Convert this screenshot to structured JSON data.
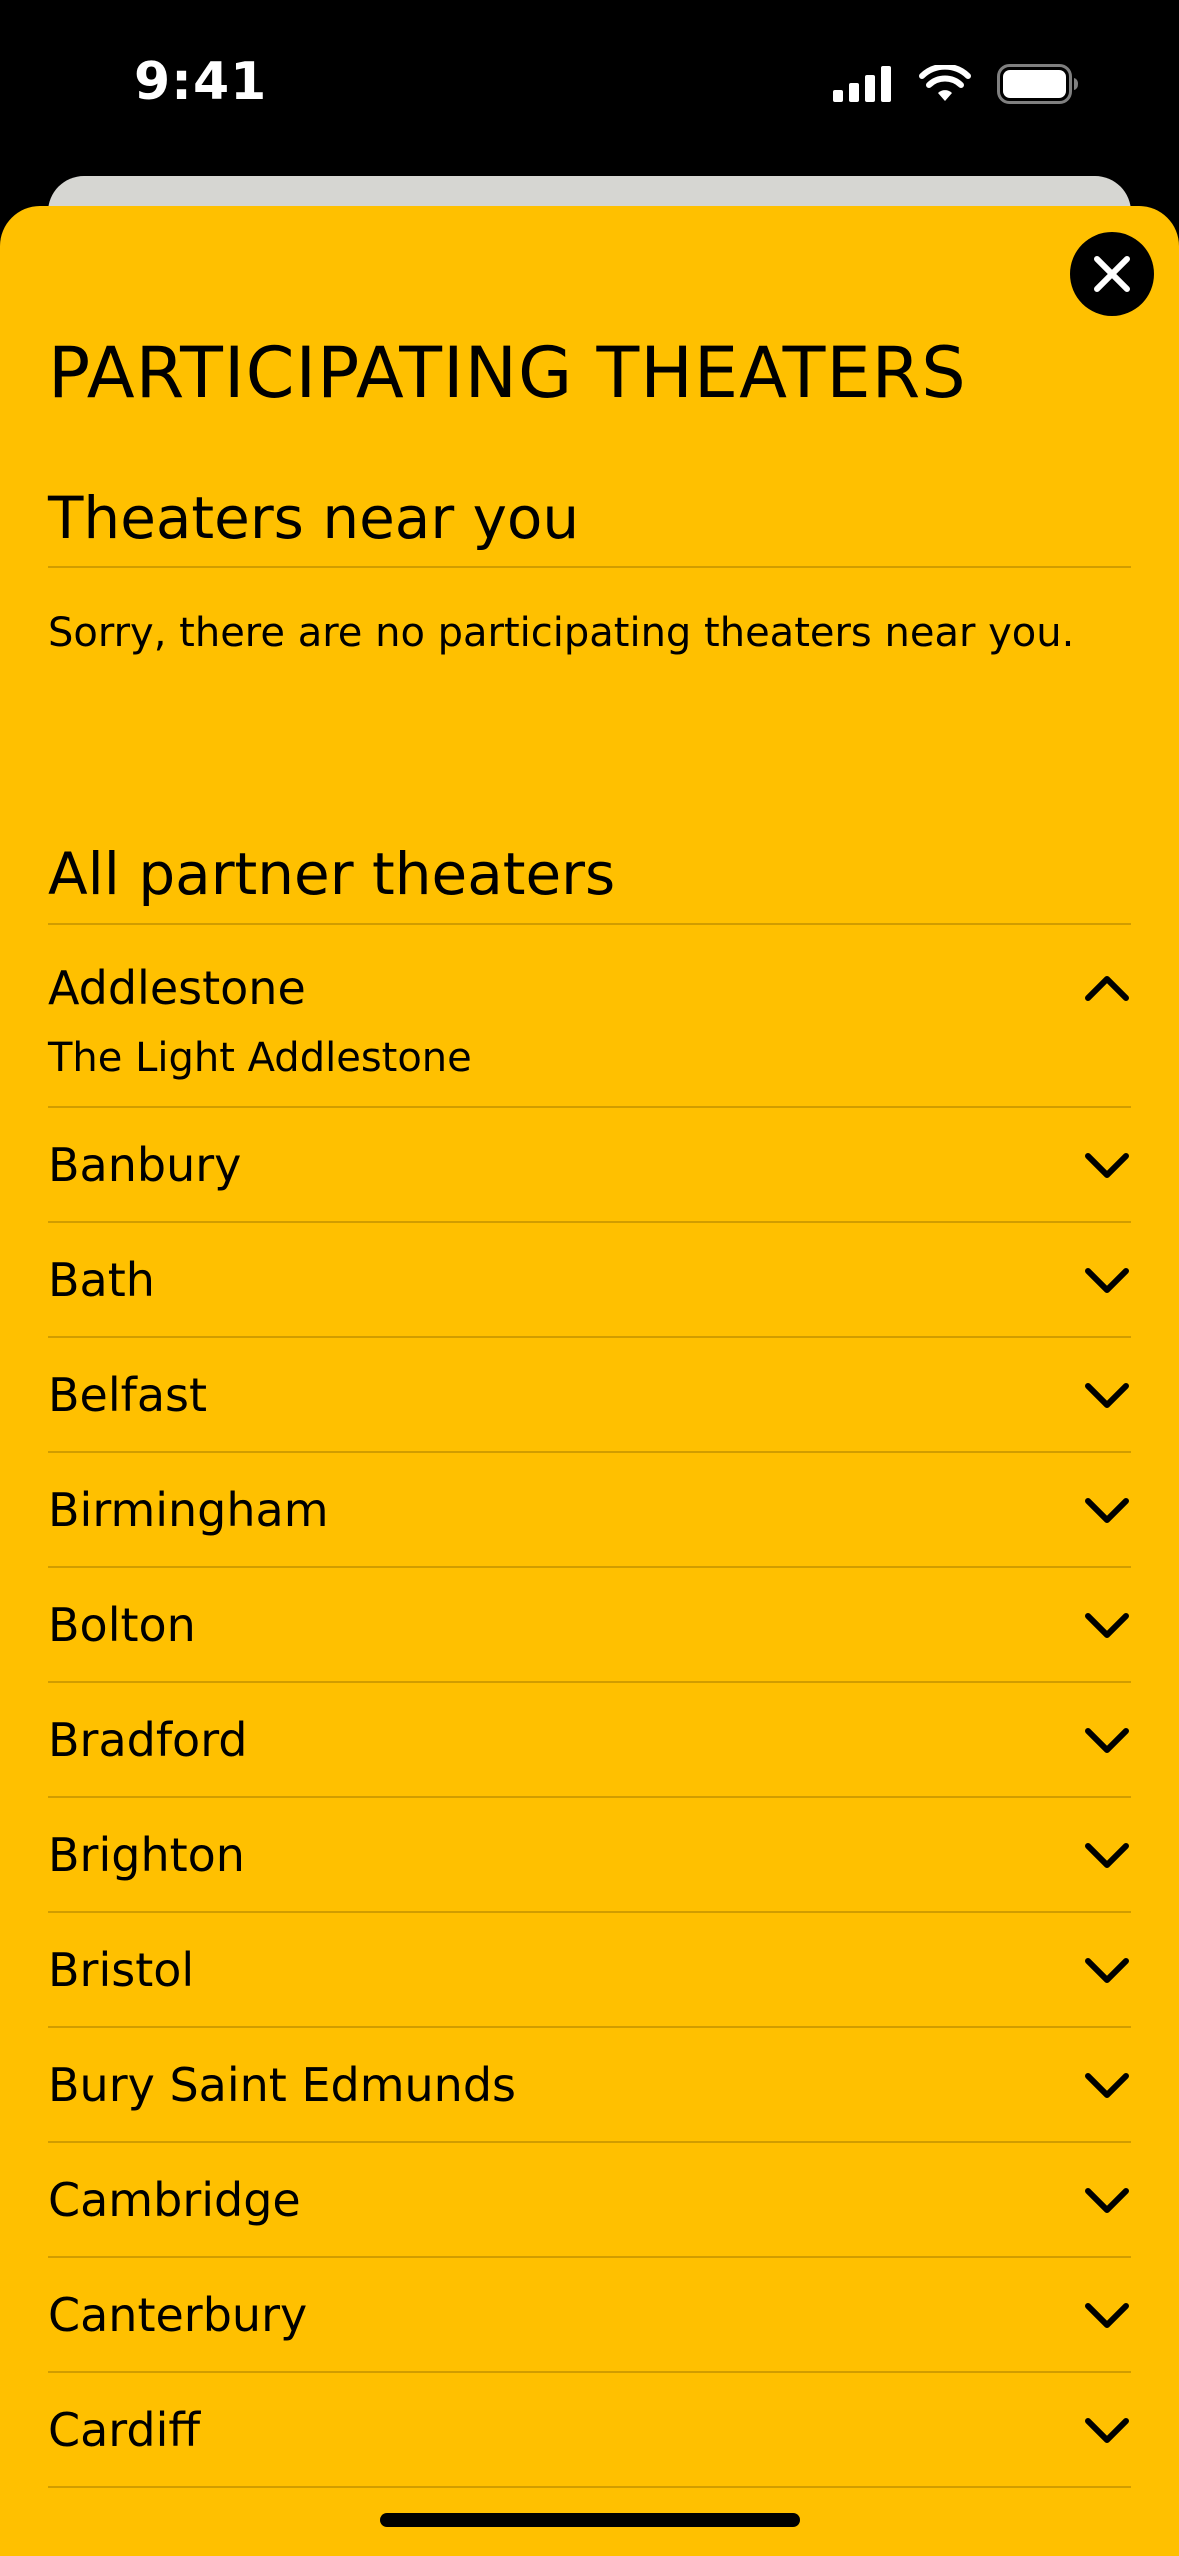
{
  "status_bar": {
    "time": "9:41"
  },
  "modal": {
    "title": "PARTICIPATING THEATERS",
    "close_icon": "close-icon",
    "near_section": {
      "title": "Theaters near you",
      "empty_message": "Sorry, there are no participating theaters near you."
    },
    "all_section": {
      "title": "All partner theaters",
      "cities": [
        {
          "name": "Addlestone",
          "expanded": true,
          "theaters": [
            "The Light Addlestone"
          ]
        },
        {
          "name": "Banbury",
          "expanded": false
        },
        {
          "name": "Bath",
          "expanded": false
        },
        {
          "name": "Belfast",
          "expanded": false
        },
        {
          "name": "Birmingham",
          "expanded": false
        },
        {
          "name": "Bolton",
          "expanded": false
        },
        {
          "name": "Bradford",
          "expanded": false
        },
        {
          "name": "Brighton",
          "expanded": false
        },
        {
          "name": "Bristol",
          "expanded": false
        },
        {
          "name": "Bury Saint Edmunds",
          "expanded": false
        },
        {
          "name": "Cambridge",
          "expanded": false
        },
        {
          "name": "Canterbury",
          "expanded": false
        },
        {
          "name": "Cardiff",
          "expanded": false
        }
      ]
    }
  },
  "colors": {
    "sheet_background": "#FFC000",
    "text": "#000000",
    "status_bar_background": "#000000"
  }
}
